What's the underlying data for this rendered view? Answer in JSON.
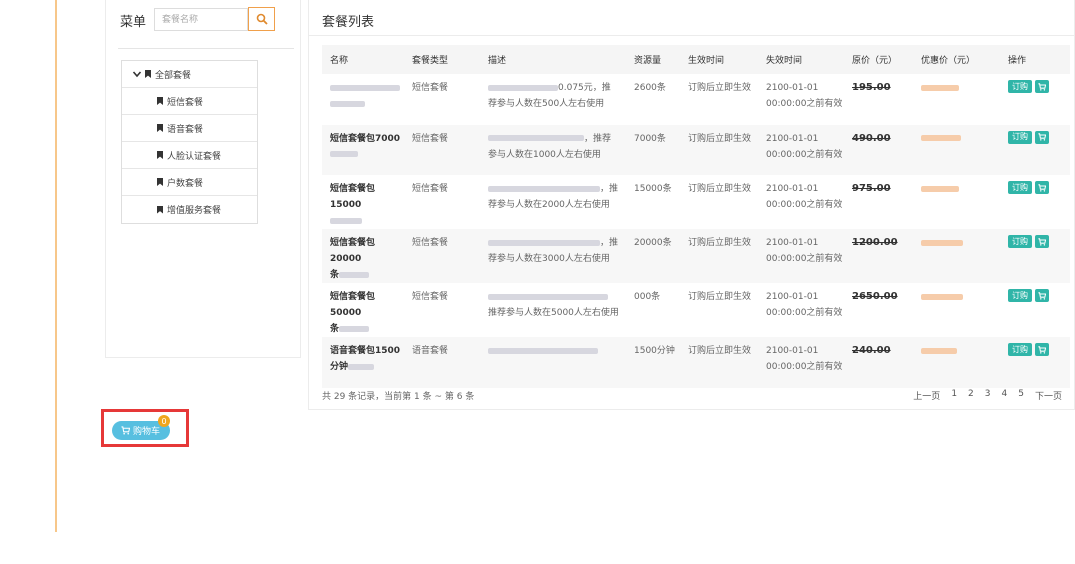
{
  "colors": {
    "accent": "#f0a04b",
    "teal": "#30b5a8",
    "cart_blue": "#57bfe0",
    "highlight": "#e63838"
  },
  "sidebar": {
    "title": "菜单",
    "search_placeholder": "套餐名称",
    "tree": [
      {
        "label": "全部套餐",
        "root": true
      },
      {
        "label": "短信套餐"
      },
      {
        "label": "语音套餐"
      },
      {
        "label": "人脸认证套餐"
      },
      {
        "label": "户数套餐"
      },
      {
        "label": "增值服务套餐"
      }
    ]
  },
  "main": {
    "title": "套餐列表",
    "columns": [
      "名称",
      "套餐类型",
      "描述",
      "资源量",
      "生效时间",
      "失效时间",
      "原价（元）",
      "优惠价（元）",
      "操作"
    ],
    "rows": [
      {
        "name_a": "",
        "name_b": "",
        "name_blur": [
          70,
          35
        ],
        "type": "短信套餐",
        "desc1_blur": 70,
        "desc1_suffix": "0.075元，推",
        "desc2": "荐参与人数在500人左右使用",
        "amount": "2600条",
        "start": "订购后立即生效",
        "end1": "2100-01-01",
        "end2": "00:00:00之前有效",
        "orig": "195.00",
        "disc_blur": 38
      },
      {
        "name_a": "短信套餐包7000",
        "name_b": "",
        "name_blur": [
          0,
          28
        ],
        "type": "短信套餐",
        "desc1_blur": 96,
        "desc1_suffix": "，推荐",
        "desc2": "参与人数在1000人左右使用",
        "amount": "7000条",
        "start": "订购后立即生效",
        "end1": "2100-01-01",
        "end2": "00:00:00之前有效",
        "orig": "490.00",
        "disc_blur": 40
      },
      {
        "name_a": "短信套餐包15000",
        "name_b": "",
        "name_blur": [
          0,
          32
        ],
        "type": "短信套餐",
        "desc1_blur": 112,
        "desc1_suffix": "，推",
        "desc2": "荐参与人数在2000人左右使用",
        "amount": "15000条",
        "start": "订购后立即生效",
        "end1": "2100-01-01",
        "end2": "00:00:00之前有效",
        "orig": "975.00",
        "disc_blur": 38
      },
      {
        "name_a": "短信套餐包20000",
        "name_b": "条",
        "name_blur": [
          0,
          30
        ],
        "type": "短信套餐",
        "desc1_blur": 112,
        "desc1_suffix": "，推",
        "desc2": "荐参与人数在3000人左右使用",
        "amount": "20000条",
        "start": "订购后立即生效",
        "end1": "2100-01-01",
        "end2": "00:00:00之前有效",
        "orig": "1200.00",
        "disc_blur": 42
      },
      {
        "name_a": "短信套餐包50000",
        "name_b": "条",
        "name_blur": [
          0,
          30
        ],
        "type": "短信套餐",
        "desc1_blur": 120,
        "desc1_suffix": "",
        "desc2": "推荐参与人数在5000人左右使用",
        "amount": "000条",
        "start": "订购后立即生效",
        "end1": "2100-01-01",
        "end2": "00:00:00之前有效",
        "orig": "2650.00",
        "disc_blur": 42
      },
      {
        "name_a": "语音套餐包1500",
        "name_b": "分钟",
        "name_blur": [
          0,
          26
        ],
        "type": "语音套餐",
        "desc1_blur": 110,
        "desc1_suffix": "",
        "desc2": "",
        "amount": "1500分钟",
        "start": "订购后立即生效",
        "end1": "2100-01-01",
        "end2": "00:00:00之前有效",
        "orig": "240.00",
        "disc_blur": 36
      }
    ],
    "order_label": "订购",
    "footer_info": "共 29 条记录，当前第 1 条 ~ 第 6 条",
    "pager": [
      "上一页",
      "1",
      "2",
      "3",
      "4",
      "5",
      "下一页"
    ]
  },
  "cart": {
    "label": "购物车",
    "count": "0"
  }
}
